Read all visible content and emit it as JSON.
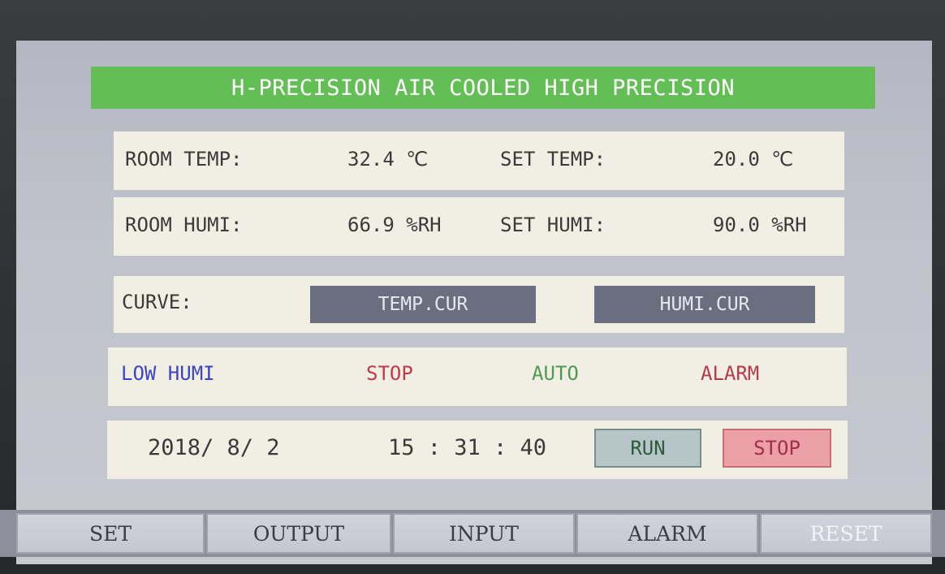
{
  "header": {
    "title": "H-PRECISION AIR COOLED HIGH PRECISION"
  },
  "temperature": {
    "room_label": "ROOM TEMP:",
    "room_value": "32.4 ℃",
    "set_label": "SET TEMP:",
    "set_value": "20.0 ℃"
  },
  "humidity": {
    "room_label": "ROOM HUMI:",
    "room_value": "66.9 %RH",
    "set_label": "SET HUMI:",
    "set_value": "90.0 %RH"
  },
  "curve": {
    "label": "CURVE:",
    "temp_button": "TEMP.CUR",
    "humi_button": "HUMI.CUR"
  },
  "status": {
    "items": [
      {
        "text": "LOW HUMI",
        "color": "#3b43c8"
      },
      {
        "text": "STOP",
        "color": "#c23a4a"
      },
      {
        "text": "AUTO",
        "color": "#4e9a55"
      },
      {
        "text": "ALARM",
        "color": "#b73a4c"
      }
    ]
  },
  "clock": {
    "date": "2018/ 8/ 2",
    "time": "15 : 31 : 40",
    "run_button": "RUN",
    "stop_button": "STOP"
  },
  "tabs": [
    {
      "label": "SET"
    },
    {
      "label": "OUTPUT"
    },
    {
      "label": "INPUT"
    },
    {
      "label": "ALARM"
    },
    {
      "label": "RESET"
    }
  ],
  "colors": {
    "title_bar": "#63bf55",
    "panel": "#f1efe3",
    "curve_button": "#6b6e7e"
  }
}
